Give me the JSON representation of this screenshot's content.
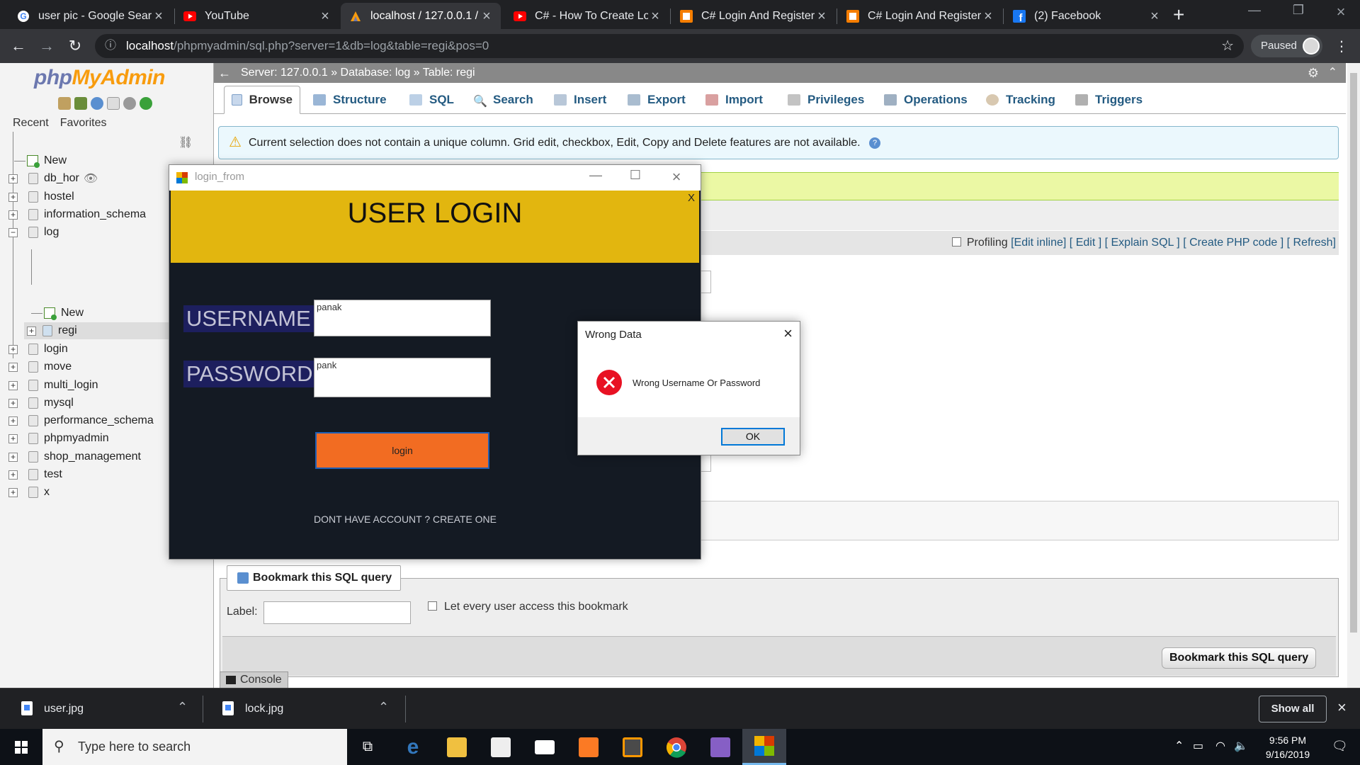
{
  "browser": {
    "tabs": [
      {
        "title": "user pic - Google Searc",
        "favicon": "google-icon",
        "active": false
      },
      {
        "title": "YouTube",
        "favicon": "youtube-icon",
        "active": false
      },
      {
        "title": "localhost / 127.0.0.1 / l",
        "favicon": "phpmyadmin-icon",
        "active": true
      },
      {
        "title": "C# - How To Create Lo",
        "favicon": "youtube-icon",
        "active": false
      },
      {
        "title": "C# Login And Register",
        "favicon": "blogger-icon",
        "active": false
      },
      {
        "title": "C# Login And Register",
        "favicon": "blogger-icon",
        "active": false
      },
      {
        "title": "(2) Facebook",
        "favicon": "facebook-icon",
        "active": false
      }
    ],
    "url_host": "localhost",
    "url_path": "/phpmyadmin/sql.php?server=1&db=log&table=regi&pos=0",
    "profile_label": "Paused"
  },
  "pma": {
    "logo_php": "php",
    "logo_myadmin": "MyAdmin",
    "recent_label": "Recent",
    "favorites_label": "Favorites",
    "tree": {
      "new": "New",
      "db_hor": "db_hor",
      "hostel": "hostel",
      "information_schema": "information_schema",
      "log": "log",
      "log_new": "New",
      "regi": "regi",
      "login": "login",
      "move": "move",
      "multi_login": "multi_login",
      "mysql": "mysql",
      "performance_schema": "performance_schema",
      "phpmyadmin": "phpmyadmin",
      "shop_management": "shop_management",
      "test": "test",
      "x": "x"
    },
    "breadcrumb": {
      "server": "Server: 127.0.0.1 »",
      "database": "Database: log »",
      "table": "Table: regi"
    },
    "tabs": {
      "browse": "Browse",
      "structure": "Structure",
      "sql": "SQL",
      "search": "Search",
      "insert": "Insert",
      "export": "Export",
      "import": "Import",
      "privileges": "Privileges",
      "operations": "Operations",
      "tracking": "Tracking",
      "triggers": "Triggers"
    },
    "notice": "Current selection does not contain a unique column. Grid edit, checkbox, Edit, Copy and Delete features are not available.",
    "profiling": {
      "label": "Profiling",
      "edit_inline": "[Edit inline]",
      "edit": "[ Edit ]",
      "explain": "[ Explain SQL ]",
      "create_php": "[ Create PHP code ]",
      "refresh": "[ Refresh]"
    },
    "bookmark": {
      "legend": "Bookmark this SQL query",
      "label": "Label:",
      "every_user": "Let every user access this bookmark",
      "button": "Bookmark this SQL query"
    },
    "console": "Console"
  },
  "login_window": {
    "title": "login_from",
    "heading": "USER LOGIN",
    "close_x": "X",
    "username_label": "USERNAME",
    "username_value": "panak",
    "password_label": "PASSWORD",
    "password_value": "pank",
    "login_button": "login",
    "create_link": "DONT HAVE ACCOUNT ? CREATE ONE",
    "header_color": "#e2b60f",
    "body_color": "#141a23",
    "button_color": "#f26c22"
  },
  "message_box": {
    "title": "Wrong Data",
    "message": "Wrong Username Or Password",
    "ok": "OK",
    "icon": "error-icon"
  },
  "downloads": {
    "items": [
      "user.jpg",
      "lock.jpg"
    ],
    "show_all": "Show all"
  },
  "taskbar": {
    "search_placeholder": "Type here to search",
    "time": "9:56 PM",
    "date": "9/16/2019"
  }
}
